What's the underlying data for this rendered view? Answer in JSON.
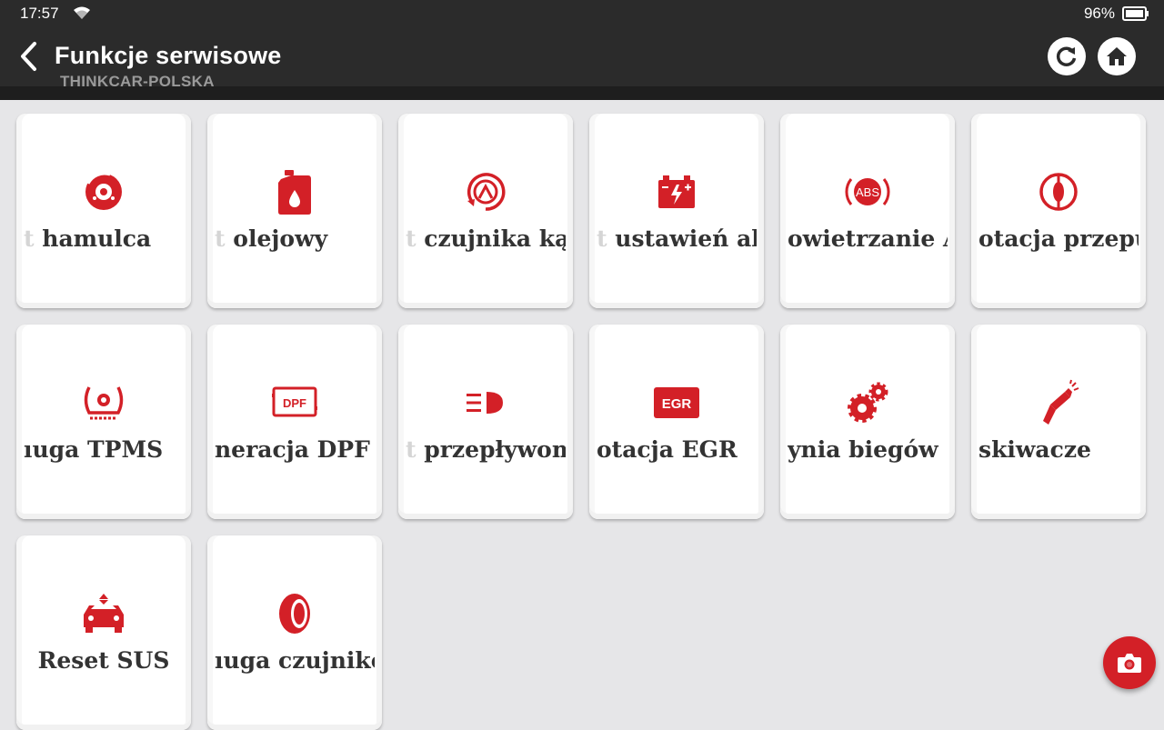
{
  "status_bar": {
    "time": "17:57",
    "battery": "96%"
  },
  "header": {
    "title": "Funkcje serwisowe",
    "subtitle": "THINKCAR-POLSKA"
  },
  "accent_color": "#d32027",
  "tiles": [
    {
      "label_fade": "t ",
      "label": "hamulca",
      "icon": "brake-disc-icon"
    },
    {
      "label_fade": "t ",
      "label": "olejowy",
      "icon": "oil-can-icon"
    },
    {
      "label_fade": "t ",
      "label": "czujnika kąta",
      "icon": "steering-angle-icon"
    },
    {
      "label_fade": "t ",
      "label": "ustawień aku",
      "icon": "battery-icon"
    },
    {
      "label_fade": "",
      "label": "owietrzanie ABS",
      "icon": "abs-icon"
    },
    {
      "label_fade": "",
      "label": "otacja przepustnicy",
      "icon": "throttle-icon"
    },
    {
      "label_fade": "",
      "label": "ıuga TPMS",
      "icon": "tpms-icon"
    },
    {
      "label_fade": "",
      "label": "neracja DPF",
      "icon": "dpf-icon"
    },
    {
      "label_fade": "t ",
      "label": "przepływom",
      "icon": "headlight-icon"
    },
    {
      "label_fade": "",
      "label": "otacja EGR",
      "icon": "egr-icon"
    },
    {
      "label_fade": "",
      "label": "ynia biegów",
      "icon": "gears-icon"
    },
    {
      "label_fade": "",
      "label": "skiwacze",
      "icon": "injector-icon"
    },
    {
      "label_fade": "",
      "label": "Reset SUS",
      "icon": "suspension-icon"
    },
    {
      "label_fade": "",
      "label": "ıuga czujników",
      "icon": "tire-icon"
    }
  ]
}
